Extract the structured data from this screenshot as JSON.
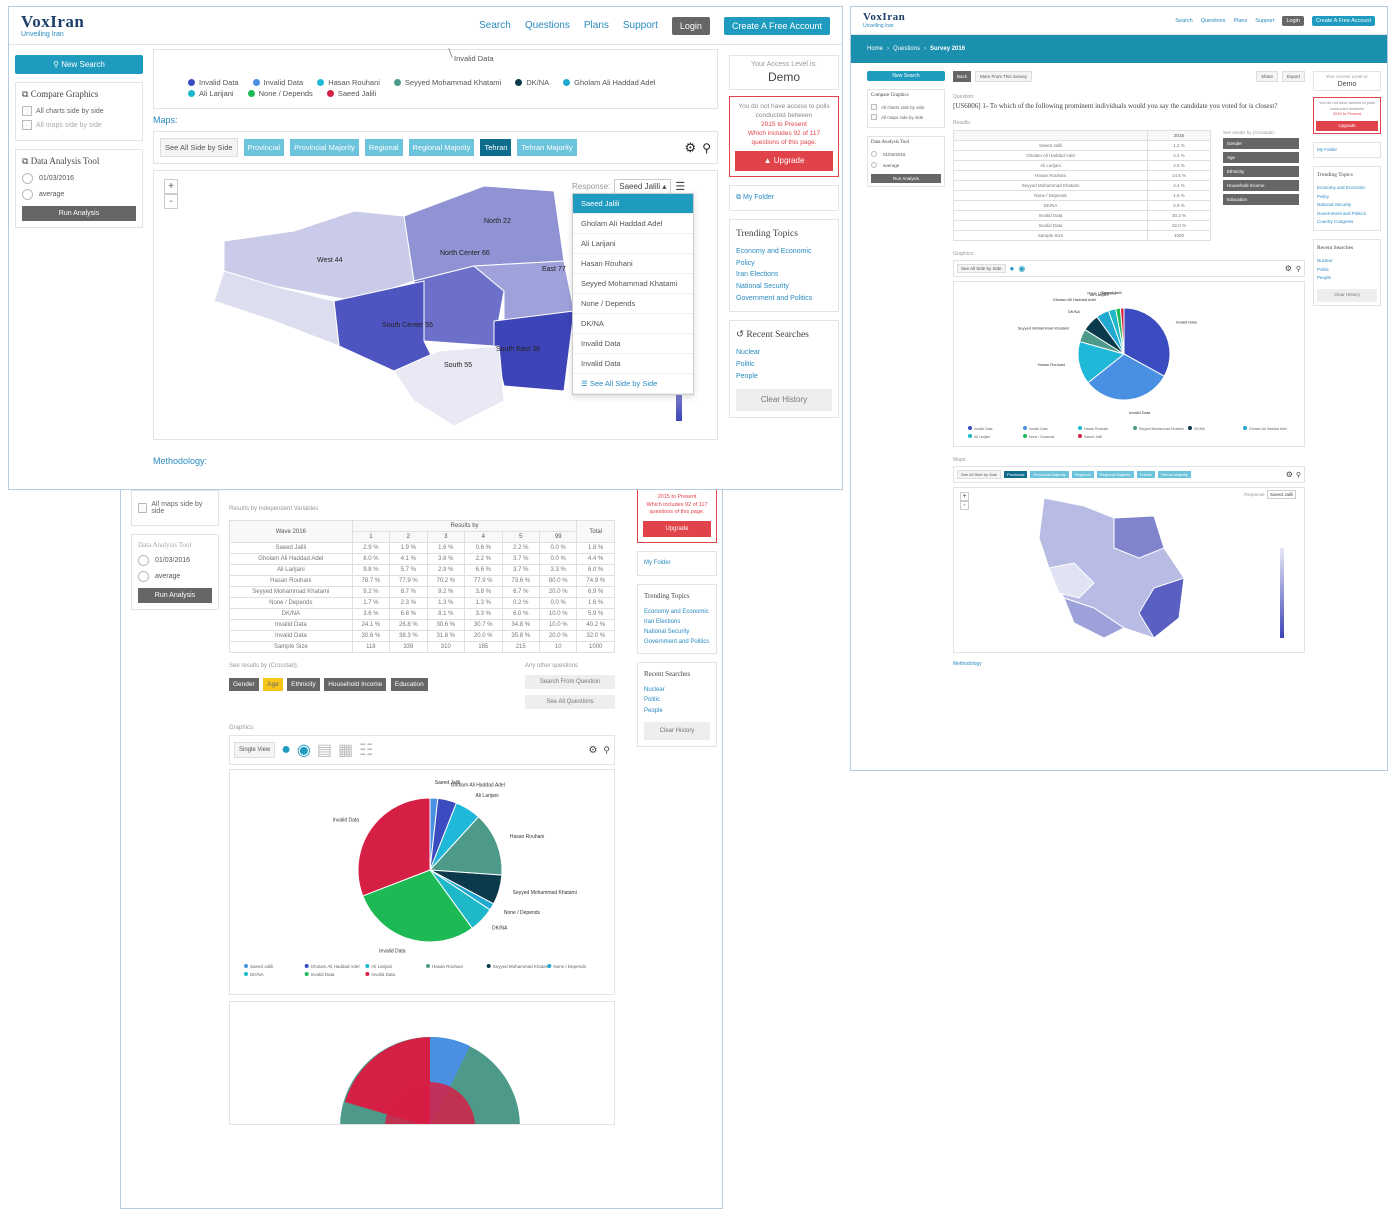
{
  "brand": {
    "name": "VoxIran",
    "tagline": "Unveiling Iran"
  },
  "nav": {
    "search": "Search",
    "questions": "Questions",
    "plans": "Plans",
    "support": "Support",
    "login": "Login",
    "create": "Create A Free Account"
  },
  "sidebar": {
    "new_search": "New Search",
    "compare_title": "Compare Graphics",
    "compare_opt1": "All charts side by side",
    "compare_opt2": "All maps side by side",
    "analysis_title": "Data Analysis Tool",
    "analysis_opt1": "01/03/2016",
    "analysis_opt2": "average",
    "run": "Run Analysis"
  },
  "access": {
    "label": "Your Access Level is:",
    "level": "Demo",
    "warning": "You do not have access to polls conducted between",
    "range": "2015 to Present",
    "includes": "Which includes 92 of 117 questions of this page.",
    "upgrade": "Upgrade"
  },
  "right": {
    "folder": "My Folder",
    "trending_title": "Trending Topics",
    "trending": [
      "Economy and Economic",
      "Policy",
      "Iran Elections",
      "National Security",
      "Government and Politics"
    ],
    "recent_title": "Recent Searches",
    "recent": [
      "Nuclear",
      "Politic",
      "People"
    ],
    "clear": "Clear History"
  },
  "legend": {
    "top_label": "Invalid Data",
    "items": [
      {
        "name": "Invalid Data",
        "color": "#3b4cc0"
      },
      {
        "name": "Invalid Data",
        "color": "#4a90e2"
      },
      {
        "name": "Hasan Rouhani",
        "color": "#20b8d8"
      },
      {
        "name": "Seyyed Mohammad Khatami",
        "color": "#4e9a8a"
      },
      {
        "name": "DK/NA",
        "color": "#0b3a4c"
      },
      {
        "name": "Gholam Ali Haddad Adel",
        "color": "#1fa8d0"
      },
      {
        "name": "Ali Larijani",
        "color": "#1fb8c8"
      },
      {
        "name": "None / Depends",
        "color": "#1db954"
      },
      {
        "name": "Saeed Jalili",
        "color": "#d61f45"
      }
    ]
  },
  "maps": {
    "label": "Maps:",
    "tabs": [
      "See All Side by Side",
      "Provincial",
      "Provincial Majority",
      "Regional",
      "Regional Majority",
      "Tehran",
      "Tehran Majority"
    ],
    "response_label": "Response:",
    "response_value": "Saeed Jalili",
    "options": [
      "Saeed Jalili",
      "Gholam Ali Haddad Adel",
      "Ali Larijani",
      "Hasan Rouhani",
      "Seyyed Mohammad Khatami",
      "None / Depends",
      "DK/NA",
      "Invalid Data",
      "Invalid Data"
    ],
    "see_all": "See All Side by Side",
    "regions": [
      "North 22",
      "West 44",
      "North Center 66",
      "East 77",
      "South Center 55",
      "South East 38",
      "South 55"
    ],
    "scale": [
      "8",
      "6",
      "4",
      "2",
      "0"
    ]
  },
  "methodology": "Methodology:",
  "table": {
    "caption": "Results by Independent Variables",
    "header_group": "Results by",
    "wave": "Wave 2016",
    "cols": [
      "1",
      "2",
      "3",
      "4",
      "5",
      "99",
      "Total"
    ],
    "rows": [
      [
        "Saeed Jalili",
        "2.9 %",
        "1.9 %",
        "1.6 %",
        "0.6 %",
        "2.2 %",
        "0.0 %",
        "1.8 %"
      ],
      [
        "Gholam Ali Haddad Adel",
        "8.0 %",
        "4.1 %",
        "3.8 %",
        "2.2 %",
        "3.7 %",
        "0.0 %",
        "4.4 %"
      ],
      [
        "Ali Larijani",
        "9.8 %",
        "5.7 %",
        "2.9 %",
        "6.6 %",
        "3.7 %",
        "3.3 %",
        "6.0 %"
      ],
      [
        "Hasan Rouhani",
        "78.7 %",
        "77.9 %",
        "70.2 %",
        "77.9 %",
        "73.6 %",
        "80.0 %",
        "74.9 %"
      ],
      [
        "Seyyed Mohammad Khatami",
        "9.2 %",
        "8.7 %",
        "9.2 %",
        "3.8 %",
        "6.7 %",
        "20.0 %",
        "6.9 %"
      ],
      [
        "None / Depends",
        "1.7 %",
        "2.3 %",
        "1.3 %",
        "1.3 %",
        "0.2 %",
        "0.0 %",
        "1.6 %"
      ],
      [
        "DK/NA",
        "3.6 %",
        "6.8 %",
        "8.1 %",
        "3.3 %",
        "6.0 %",
        "10.0 %",
        "5.9 %"
      ],
      [
        "Invalid Data",
        "24.1 %",
        "26.8 %",
        "30.6 %",
        "30.7 %",
        "34.8 %",
        "10.0 %",
        "40.2 %"
      ],
      [
        "Invalid Data",
        "30.6 %",
        "38.3 %",
        "31.8 %",
        "20.0 %",
        "35.8 %",
        "20.0 %",
        "32.0 %"
      ],
      [
        "Sample Size",
        "118",
        "339",
        "310",
        "185",
        "215",
        "10",
        "1000"
      ]
    ],
    "see_results": "See results by (Crosstab):",
    "groups": [
      "Gender",
      "Age",
      "Ethnicity",
      "Household Income",
      "Education"
    ],
    "other_q": "Any other questions",
    "search_q": "Search From Question",
    "see_all_q": "See All Questions"
  },
  "graphics": {
    "label": "Graphics:",
    "view": "Single View",
    "pie_labels": [
      "Saeed Jalili",
      "Gholam Ali Haddad Adel",
      "Ali Larijani",
      "Hasan Rouhani",
      "Seyyed Mohammad Khatami",
      "None / Depends",
      "DK/NA",
      "Invalid Data",
      "Invalid Data"
    ]
  },
  "window_c": {
    "breadcrumb": [
      "Home",
      "Questions",
      "Survey 2016"
    ],
    "back": "Back",
    "more": "More From This Survey",
    "share": "Share",
    "export": "Export",
    "question_label": "Question:",
    "question": "[US6806] 1- To which of the following prominent individuals would you say the candidate you voted for is closest?",
    "results": "Results:",
    "col_year": "2016",
    "rows": [
      [
        "Saeed Jalili",
        "1.2 %"
      ],
      [
        "Gholam Ali Haddad Adel",
        "4.4 %"
      ],
      [
        "Ali Larijani",
        "2.5 %"
      ],
      [
        "Hasan Rouhani",
        "14.6 %"
      ],
      [
        "Seyyed Mohammad Khatami",
        "4.4 %"
      ],
      [
        "None / Depends",
        "1.6 %"
      ],
      [
        "DK/NA",
        "5.9 %"
      ],
      [
        "Invalid Data",
        "30.3 %"
      ],
      [
        "Invalid Data",
        "32.0 %"
      ],
      [
        "Sample Size",
        "1000"
      ]
    ],
    "crosstab": "See results by (Crosstab):",
    "groups": [
      "Gender",
      "Age",
      "Ethnicity",
      "Household Income",
      "Education"
    ],
    "graphics": "Graphics:",
    "maps": "Maps:",
    "methodology": "Methodology",
    "trending": [
      "Economy and Economic",
      "Policy",
      "National Security",
      "Government and Politics",
      "Country Congress"
    ],
    "recent": [
      "Nuclear",
      "Politic",
      "People"
    ],
    "clear": "Clear History"
  },
  "colors": {
    "accent": "#1f9bbf",
    "teal": "#1a8fae",
    "red": "#e1434a",
    "navy": "#1e3f6a"
  }
}
